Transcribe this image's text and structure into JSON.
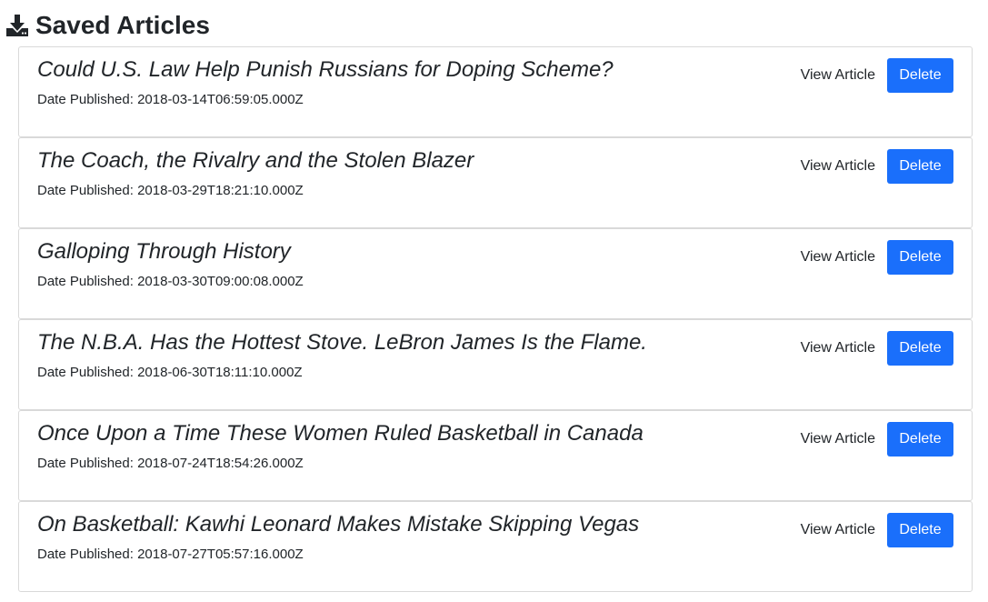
{
  "header": {
    "icon": "download-icon",
    "title": "Saved Articles"
  },
  "articles": [
    {
      "title": "Could U.S. Law Help Punish Russians for Doping Scheme?",
      "date_line": "Date Published: 2018-03-14T06:59:05.000Z",
      "view_label": "View Article",
      "delete_label": "Delete"
    },
    {
      "title": "The Coach, the Rivalry and the Stolen Blazer",
      "date_line": "Date Published: 2018-03-29T18:21:10.000Z",
      "view_label": "View Article",
      "delete_label": "Delete"
    },
    {
      "title": "Galloping Through History",
      "date_line": "Date Published: 2018-03-30T09:00:08.000Z",
      "view_label": "View Article",
      "delete_label": "Delete"
    },
    {
      "title": "The N.B.A. Has the Hottest Stove. LeBron James Is the Flame.",
      "date_line": "Date Published: 2018-06-30T18:11:10.000Z",
      "view_label": "View Article",
      "delete_label": "Delete"
    },
    {
      "title": "Once Upon a Time These Women Ruled Basketball in Canada",
      "date_line": "Date Published: 2018-07-24T18:54:26.000Z",
      "view_label": "View Article",
      "delete_label": "Delete"
    },
    {
      "title": "On Basketball: Kawhi Leonard Makes Mistake Skipping Vegas",
      "date_line": "Date Published: 2018-07-27T05:57:16.000Z",
      "view_label": "View Article",
      "delete_label": "Delete"
    }
  ],
  "colors": {
    "delete_button": "#1a6ffb",
    "card_border": "#d9d9d9"
  }
}
